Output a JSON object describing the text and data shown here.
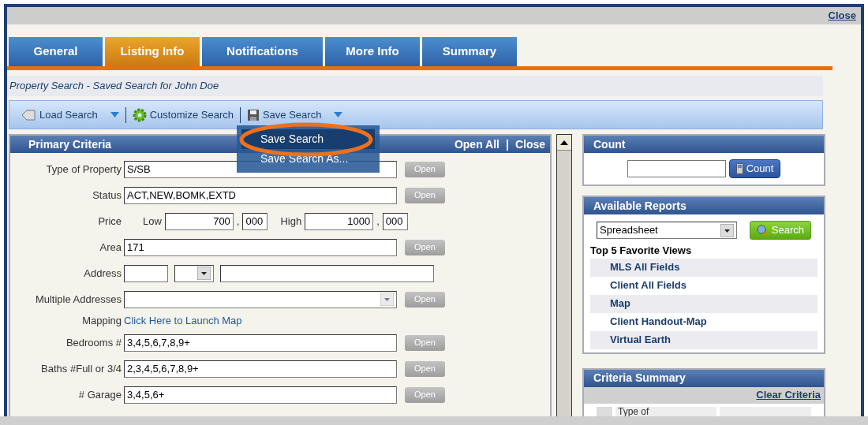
{
  "window": {
    "close": "Close"
  },
  "tabs": [
    {
      "label": "General",
      "selected": false
    },
    {
      "label": "Listing Info",
      "selected": true
    },
    {
      "label": "Notifications",
      "selected": false
    },
    {
      "label": "More Info",
      "selected": false
    },
    {
      "label": "Summary",
      "selected": false
    }
  ],
  "breadcrumb": "Property Search - Saved Search for John Doe",
  "toolbar": [
    {
      "label": "Load Search",
      "kind": "dropdown"
    },
    {
      "label": "Customize Search",
      "kind": "button"
    },
    {
      "label": "Save Search",
      "kind": "dropdown"
    }
  ],
  "menu": [
    {
      "label": "Save Search",
      "selected": true
    },
    {
      "label": "Save Search As...",
      "selected": false
    }
  ],
  "primary_criteria": {
    "title": "Primary Criteria",
    "actions": [
      "Open All",
      "Close"
    ],
    "separator": "|",
    "fields": [
      {
        "kind": "text",
        "label": "Type of Property",
        "value": "S/SB",
        "button": "Open"
      },
      {
        "kind": "text",
        "label": "Status",
        "value": "ACT,NEW,BOMK,EXTD",
        "button": "Open"
      },
      {
        "kind": "price",
        "label": "Price",
        "low_label": "Low",
        "low": "700",
        "low_suffix": "000",
        "high_label": "High",
        "high": "1000",
        "high_suffix": "000",
        "separator": ","
      },
      {
        "kind": "text",
        "label": "Area",
        "value": "171",
        "button": "Open"
      },
      {
        "kind": "address",
        "label": "Address"
      },
      {
        "kind": "combo",
        "label": "Multiple Addresses",
        "button": "Open"
      },
      {
        "kind": "link",
        "label": "Mapping",
        "link": "Click Here to Launch Map"
      },
      {
        "kind": "text",
        "label": "Bedrooms #",
        "value": "3,4,5,6,7,8,9+",
        "button": "Open"
      },
      {
        "kind": "text",
        "label": "Baths #Full or 3/4",
        "value": "2,3,4,5,6,7,8,9+",
        "button": "Open"
      },
      {
        "kind": "text",
        "label": "# Garage",
        "value": "3,4,5,6+",
        "button": "Open"
      }
    ]
  },
  "count": {
    "title": "Count",
    "button": "Count"
  },
  "reports": {
    "title": "Available Reports",
    "select": "Spreadsheet",
    "button": "Search",
    "subtitle": "Top 5 Favorite Views",
    "views": [
      "MLS All Fields",
      "Client All Fields",
      "Map",
      "Client Handout-Map",
      "Virtual Earth"
    ]
  },
  "criteria_summary": {
    "title": "Criteria Summary",
    "action": "Clear Criteria",
    "cell": "Type of"
  }
}
